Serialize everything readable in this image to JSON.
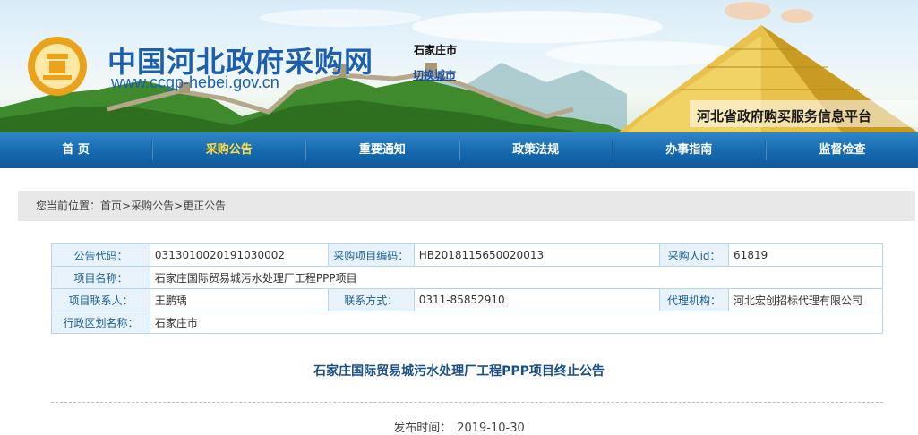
{
  "header": {
    "site_title": "中国河北政府采购网",
    "site_url": "www.ccgp-hebei.gov.cn",
    "city": "石家庄市",
    "switch_city": "切换城市",
    "platform_name": "河北省政府购买服务信息平台"
  },
  "nav": {
    "items": [
      {
        "label": "首 页"
      },
      {
        "label": "采购公告",
        "active": true
      },
      {
        "label": "重要通知"
      },
      {
        "label": "政策法规"
      },
      {
        "label": "办事指南"
      },
      {
        "label": "监督检查"
      }
    ]
  },
  "breadcrumb": {
    "lead": "您当前位置：",
    "items": [
      "首页",
      "采购公告",
      "更正公告"
    ],
    "sep": ">"
  },
  "info": {
    "rows": [
      [
        {
          "k": "公告代码：",
          "v": "0313010020191030002"
        },
        {
          "k": "采购项目编码：",
          "v": "HB2018115650020013"
        },
        {
          "k": "采购人id：",
          "v": "61819"
        }
      ],
      [
        {
          "k": "项目名称：",
          "v": "石家庄国际贸易城污水处理厂工程PPP项目"
        }
      ],
      [
        {
          "k": "项目联系人：",
          "v": "王鹏瑀"
        },
        {
          "k": "联系方式：",
          "v": "0311-85852910"
        },
        {
          "k": "代理机构：",
          "v": "河北宏创招标代理有限公司"
        }
      ],
      [
        {
          "k": "行政区划名称：",
          "v": "石家庄市"
        }
      ]
    ]
  },
  "announcement": {
    "title": "石家庄国际贸易城污水处理厂工程PPP项目终止公告",
    "publish_label": "发布时间：",
    "publish_date": "2019-10-30"
  },
  "colors": {
    "brand_blue": "#1b5fae",
    "nav_blue": "#1568ad",
    "nav_active": "#ffdd3c",
    "label_bg": "#e7f2fa",
    "border": "#b7d6ea"
  }
}
